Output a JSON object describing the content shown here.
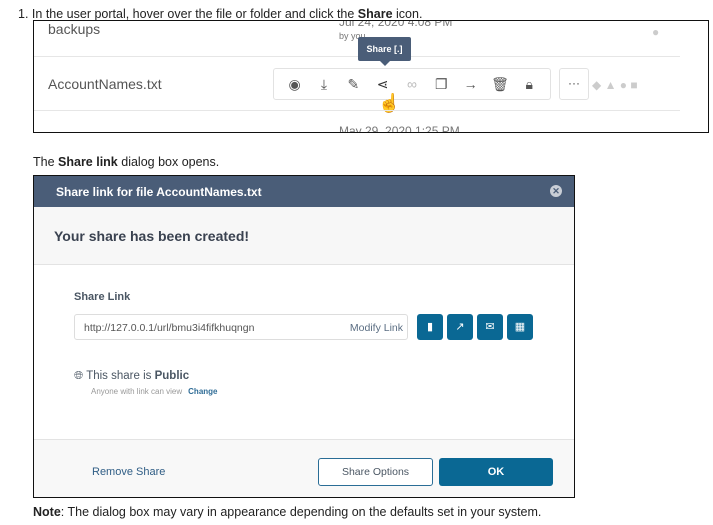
{
  "step": {
    "number": "1.",
    "text_before": "In the user portal, hover over the file or folder and click the ",
    "bold": "Share",
    "text_after": " icon."
  },
  "file_list": {
    "rows": [
      {
        "name": "backups",
        "date": "Jul 24, 2020 4:08 PM",
        "by": "by you"
      },
      {
        "name": "AccountNames.txt"
      },
      {
        "name": "",
        "date": "May 29, 2020 1:25 PM"
      }
    ],
    "tooltip": "Share [.]",
    "toolbar_icons": [
      "eye-icon",
      "download-icon",
      "edit-icon",
      "share-icon",
      "link-icon",
      "copy-icon",
      "move-arrow-icon",
      "trash-icon",
      "lock-icon"
    ],
    "more_label": "···"
  },
  "para2": {
    "before": "The ",
    "bold": "Share link",
    "after": " dialog box opens."
  },
  "dialog": {
    "title": "Share link for file AccountNames.txt",
    "success": "Your share has been created!",
    "share_link_label": "Share Link",
    "url": "http://127.0.0.1/url/bmu3i4fifkhuqngn",
    "modify_link": "Modify Link",
    "public_prefix": "This share is ",
    "public_value": "Public",
    "public_sub": "Anyone with link can view",
    "change": "Change",
    "remove_share": "Remove Share",
    "share_options": "Share Options",
    "ok": "OK",
    "colors": {
      "header": "#4a5d78",
      "primary": "#0a6894"
    }
  },
  "note": {
    "bold": "Note",
    "text": ": The dialog box may vary in appearance depending on the defaults set in your system."
  }
}
